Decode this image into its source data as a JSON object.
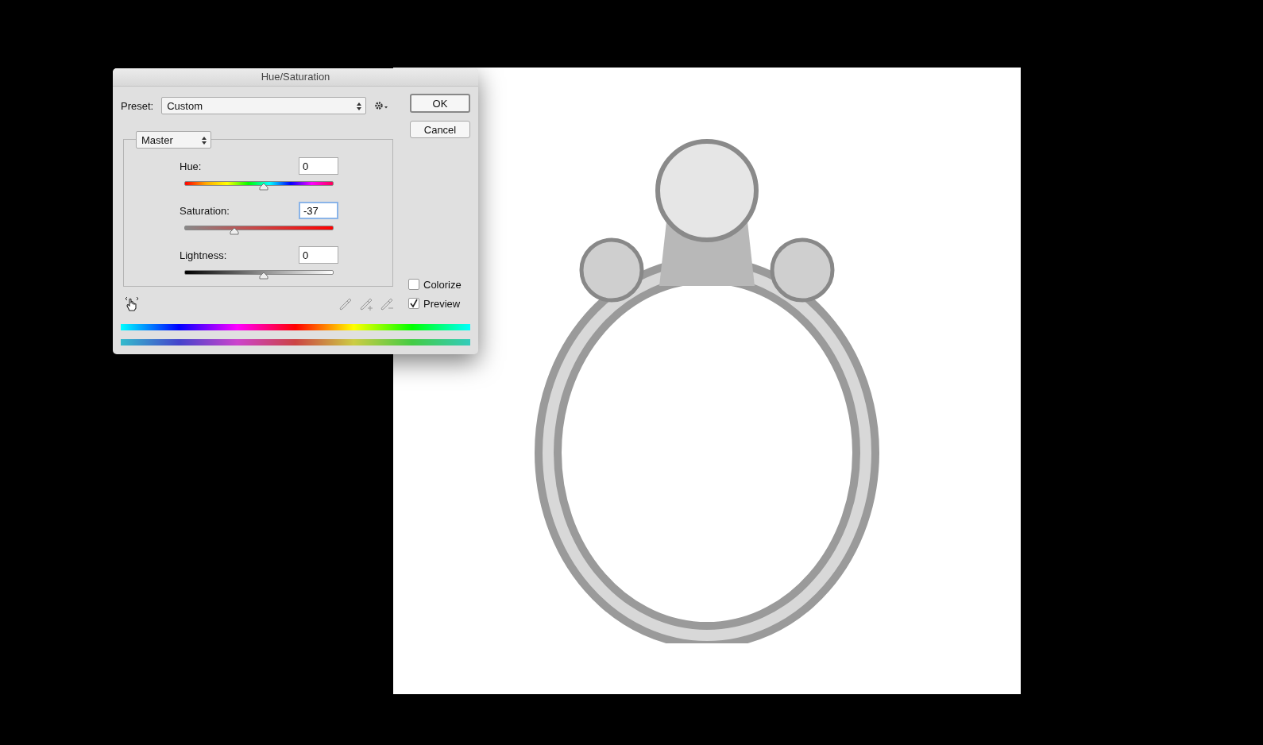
{
  "dialog": {
    "title": "Hue/Saturation",
    "preset": {
      "label": "Preset:",
      "value": "Custom"
    },
    "buttons": [
      {
        "label": "OK",
        "default": true
      },
      {
        "label": "Cancel",
        "default": false
      }
    ],
    "channel": "Master",
    "sliders": [
      {
        "kind": "hue",
        "label": "Hue:",
        "value": "0",
        "level": 0.5,
        "focused": false
      },
      {
        "kind": "saturation",
        "label": "Saturation:",
        "value": "-37",
        "level": 0.315,
        "focused": true
      },
      {
        "kind": "lightness",
        "label": "Lightness:",
        "value": "0",
        "level": 0.5,
        "focused": false
      }
    ],
    "options": [
      {
        "label": "Colorize",
        "checked": false
      },
      {
        "label": "Preview",
        "checked": true
      }
    ]
  }
}
